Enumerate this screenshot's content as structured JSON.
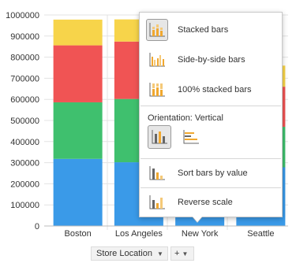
{
  "chart_data": {
    "type": "bar",
    "stacked": true,
    "categories": [
      "Boston",
      "Los Angeles",
      "New York",
      "Seattle"
    ],
    "series": [
      {
        "color": "#3a9ae8",
        "values": [
          318000,
          302000,
          295000,
          278000
        ]
      },
      {
        "color": "#3fc06e",
        "values": [
          268000,
          300000,
          290000,
          192000
        ]
      },
      {
        "color": "#f05454",
        "values": [
          270000,
          272000,
          265000,
          190000
        ]
      },
      {
        "color": "#f7d44a",
        "values": [
          122000,
          105000,
          118000,
          100000
        ]
      }
    ],
    "ylim": [
      0,
      1000000
    ],
    "yticks": [
      "0",
      "100000",
      "200000",
      "300000",
      "400000",
      "500000",
      "600000",
      "700000",
      "800000",
      "900000",
      "1000000"
    ],
    "grid": true
  },
  "x_axis_field": {
    "label": "Store Location",
    "caret": "▼"
  },
  "add_field": {
    "label": "+",
    "caret": "▼"
  },
  "menu": {
    "stacked_bars": "Stacked bars",
    "side_by_side_bars": "Side-by-side bars",
    "percent_stacked_bars": "100% stacked bars",
    "orientation_label": "Orientation: Vertical",
    "sort_bars_by_value": "Sort bars by value",
    "reverse_scale": "Reverse scale",
    "icon_colors": {
      "bars": "#f0a830",
      "axis": "#666666"
    }
  }
}
